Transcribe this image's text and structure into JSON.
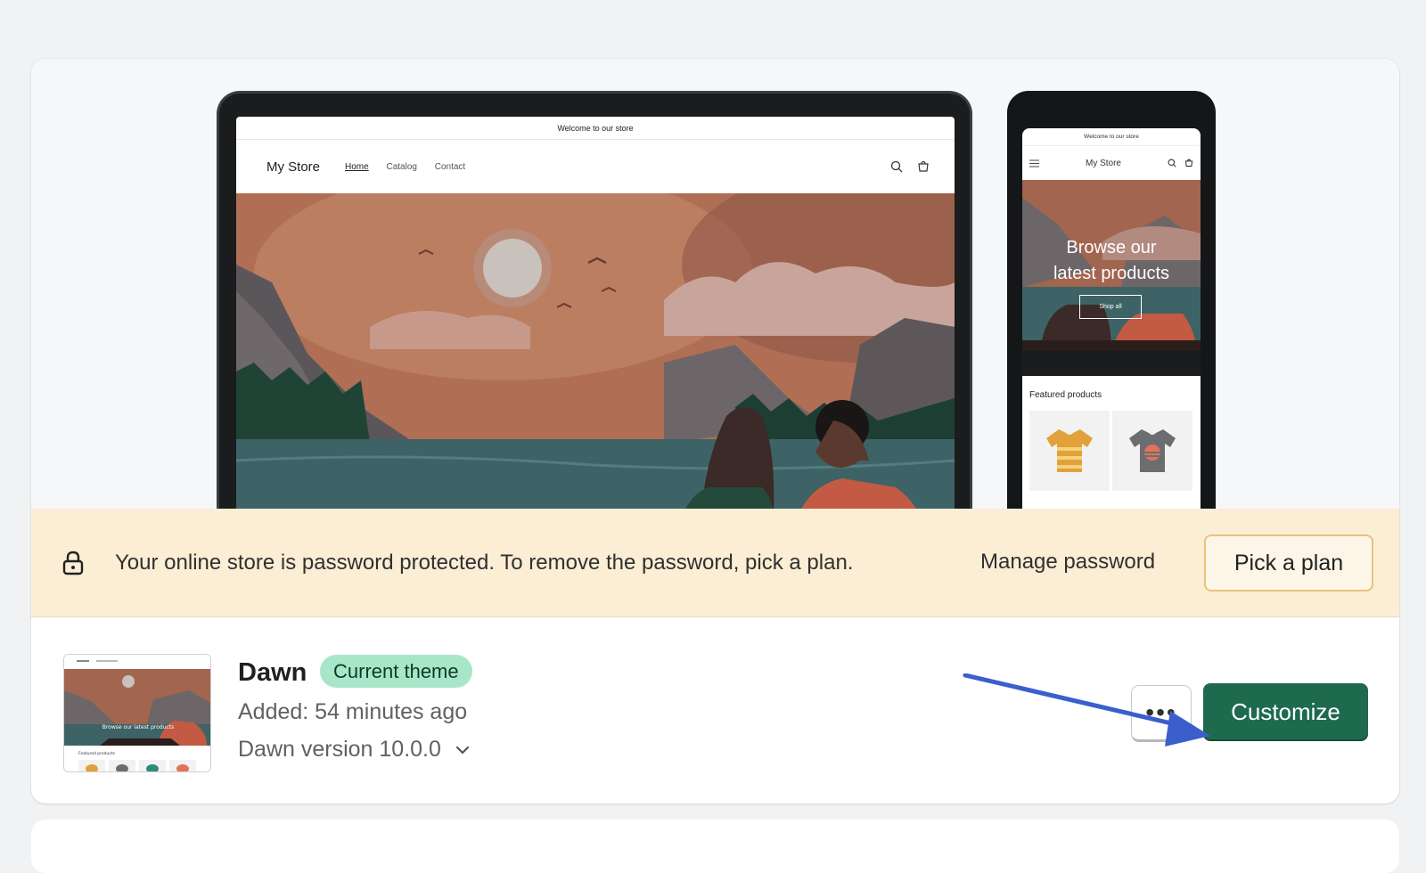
{
  "preview": {
    "desktop": {
      "announcement": "Welcome to our store",
      "store_name": "My Store",
      "nav": [
        "Home",
        "Catalog",
        "Contact"
      ]
    },
    "mobile": {
      "announcement": "Welcome to our store",
      "store_name": "My Store",
      "hero_line1": "Browse our",
      "hero_line2": "latest products",
      "shop_all": "Shop all",
      "featured_title": "Featured products"
    }
  },
  "banner": {
    "message": "Your online store is password protected. To remove the password, pick a plan.",
    "manage_password": "Manage password",
    "pick_plan": "Pick a plan",
    "background": "#fbeed5"
  },
  "theme": {
    "name": "Dawn",
    "badge": "Current theme",
    "added": "Added: 54 minutes ago",
    "version": "Dawn version 10.0.0",
    "more_label": "•••",
    "customize": "Customize",
    "thumb_hero_text": "Browse our latest products",
    "thumb_featured": "Featured products"
  },
  "colors": {
    "primary_button": "#1d6a4e",
    "badge_bg": "#a8e6c8",
    "annotation_arrow": "#3a5fcd"
  }
}
